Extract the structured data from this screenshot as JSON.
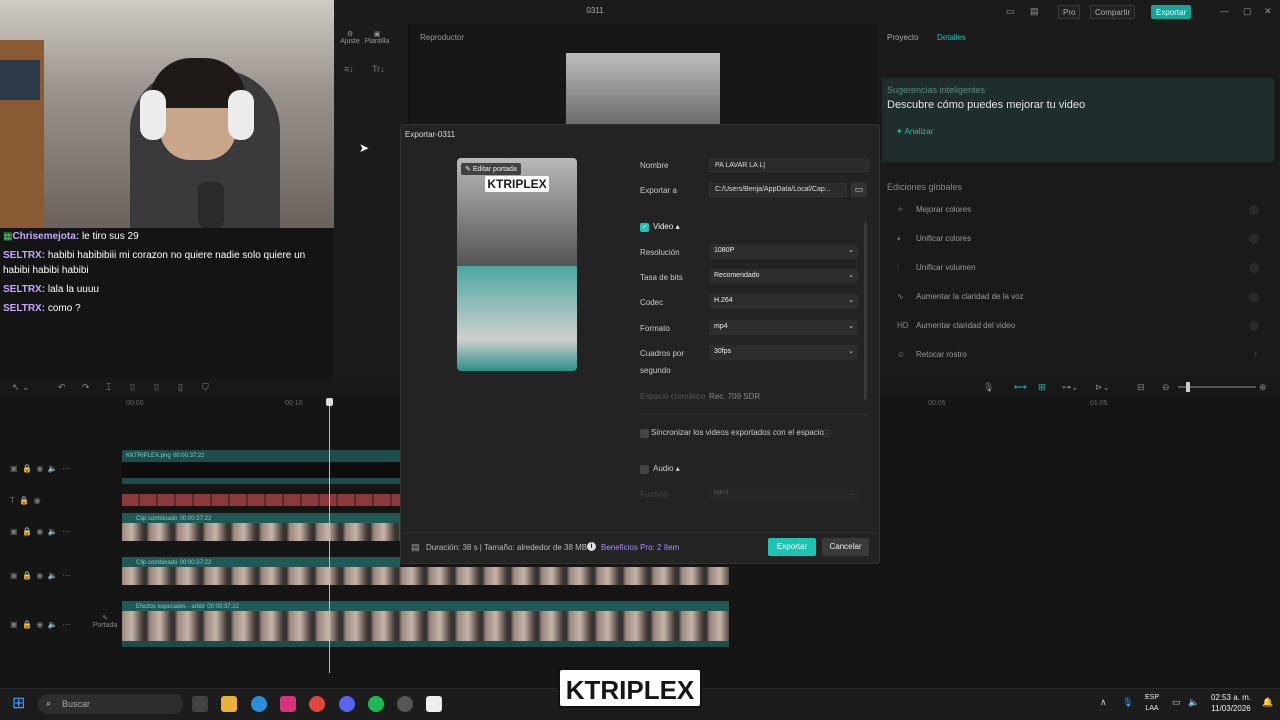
{
  "window": {
    "title": "0311",
    "pro_label": "Pro",
    "share_label": "Compartir",
    "export_label": "Exportar",
    "minimize_icon": "minimize-icon",
    "maximize_icon": "maximize-icon",
    "close_icon": "close-icon"
  },
  "left_panel": {
    "adjust_label": "Ajuste",
    "templates_label": "Plantilla"
  },
  "player": {
    "title": "Reproductor"
  },
  "chat": {
    "messages": [
      {
        "user": "Chrisemejota",
        "text": "le tiro sus 29"
      },
      {
        "user": "SELTRX",
        "text": "habibi habibibiii mi corazon no quiere nadie solo quiere un habibi habibi habibi"
      },
      {
        "user": "SELTRX",
        "text": "lala la uuuu"
      },
      {
        "user": "SELTRX",
        "text": "como ?"
      }
    ]
  },
  "right_panel": {
    "tab_project": "Proyecto",
    "tab_details": "Detalles",
    "smart_label": "Sugerencias inteligentes",
    "smart_heading": "Descubre cómo puedes mejorar tu video",
    "analyze_label": "Analizar",
    "global_heading": "Ediciones globales",
    "items": [
      {
        "icon": "improve-colors-icon",
        "label": "Mejorar colores"
      },
      {
        "icon": "unify-colors-icon",
        "label": "Unificar colores"
      },
      {
        "icon": "unify-volume-icon",
        "label": "Unificar volumen"
      },
      {
        "icon": "voice-clarity-icon",
        "label": "Aumentar la claridad de la voz"
      },
      {
        "icon": "hd-icon",
        "label": "Aumentar claridad del video"
      },
      {
        "icon": "retouch-face-icon",
        "label": "Retocar rostro"
      }
    ]
  },
  "timeline": {
    "ruler": [
      "00:00",
      "00:10",
      "00:05",
      "01:05"
    ],
    "tracks": [
      {
        "label": "KKTRIPLEX.png",
        "duration": "00:00:37:22"
      },
      {
        "label": "Clip combinado",
        "duration": "00:00:37:22"
      },
      {
        "label": "Clip combinado",
        "duration": "00:00:37:22"
      },
      {
        "label": "Efectos especiales - arbitr",
        "duration": "00:00:37:22"
      }
    ],
    "cover_label": "Portada"
  },
  "dialog": {
    "title": "Exportar-0311",
    "edit_cover": "Editar portada",
    "cover_logo": "KTRIPLEX",
    "name_label": "Nombre",
    "name_value": "PA LAVAR LA L|",
    "export_to_label": "Exportar a",
    "export_to_value": "C:/Users/Benja/AppData/Local/Cap...",
    "video_label": "Video",
    "video_checked": true,
    "resolution_label": "Resolución",
    "resolution_value": "1080P",
    "bitrate_label": "Tasa de bits",
    "bitrate_value": "Recomendado",
    "codec_label": "Codec",
    "codec_value": "H.264",
    "format_label": "Formato",
    "format_value": "mp4",
    "fps_label_1": "Cuadros por",
    "fps_label_2": "segundo",
    "fps_value": "30fps",
    "colorspace_label": "Espacio cromático",
    "colorspace_value": "Rec. 709 SDR",
    "sync_label": "Sincronizar los videos exportados con el espacio",
    "audio_label": "Audio",
    "audio_checked": false,
    "audio_format_label": "Formato",
    "audio_format_value": "MP3",
    "footer_info": "Duración: 38 s | Tamaño: alrededor de 38 MB",
    "pro_info": "Beneficios Pro: 2 ítem",
    "export_button": "Exportar",
    "cancel_button": "Cancelar"
  },
  "taskbar": {
    "search_placeholder": "Buscar",
    "brand": "KTRIPLEX",
    "lang_1": "ESP",
    "lang_2": "LAA",
    "time": "02:53 a. m.",
    "date": "11/03/2026"
  }
}
